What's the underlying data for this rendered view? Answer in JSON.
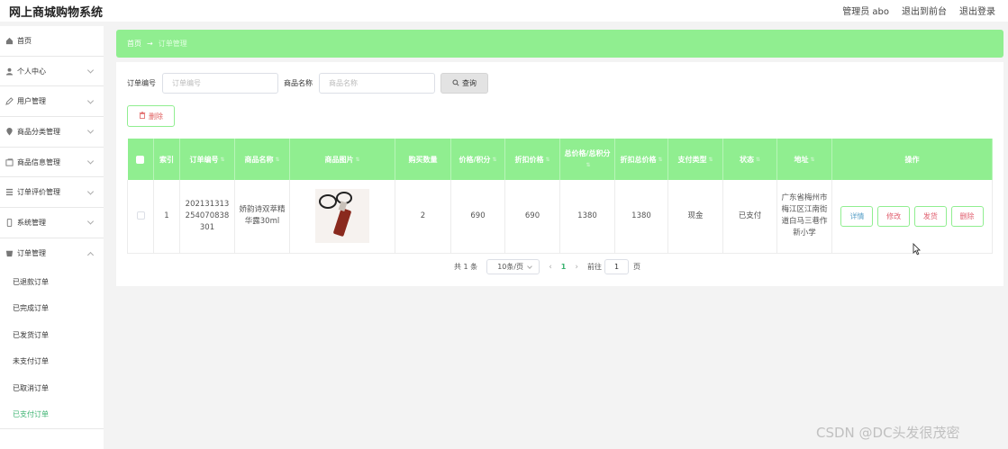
{
  "header": {
    "app_title": "网上商城购物系统",
    "admin": "管理员 abo",
    "to_front": "退出到前台",
    "logout": "退出登录"
  },
  "sidebar": {
    "items": [
      {
        "label": "首页",
        "icon": "home-icon"
      },
      {
        "label": "个人中心",
        "icon": "user-icon"
      },
      {
        "label": "用户管理",
        "icon": "edit-icon"
      },
      {
        "label": "商品分类管理",
        "icon": "location-icon"
      },
      {
        "label": "商品信息管理",
        "icon": "gallery-icon"
      },
      {
        "label": "订单评价管理",
        "icon": "list-icon"
      },
      {
        "label": "系统管理",
        "icon": "phone-icon"
      },
      {
        "label": "订单管理",
        "icon": "order-icon"
      }
    ],
    "order_sub": [
      "已退款订单",
      "已完成订单",
      "已发货订单",
      "未支付订单",
      "已取消订单",
      "已支付订单"
    ]
  },
  "breadcrumb": {
    "home": "首页",
    "arrow": "→",
    "current": "订单管理"
  },
  "search": {
    "order_no_label": "订单编号",
    "order_no_placeholder": "订单编号",
    "goods_label": "商品名称",
    "goods_placeholder": "商品名称",
    "query_button": "查询"
  },
  "actions": {
    "delete_button": "删除"
  },
  "table": {
    "headers": [
      "索引",
      "订单编号",
      "商品名称",
      "商品图片",
      "购买数量",
      "价格/积分",
      "折扣价格",
      "总价格/总积分",
      "折扣总价格",
      "支付类型",
      "状态",
      "地址",
      "操作"
    ],
    "rows": [
      {
        "index": "1",
        "order_no": "202131313254070838301",
        "goods_name": "娇韵诗双萃精华露30ml",
        "quantity": "2",
        "price": "690",
        "discount_price": "690",
        "total": "1380",
        "discount_total": "1380",
        "pay_type": "现金",
        "status": "已支付",
        "address": "广东省梅州市梅江区江南街道白马三巷作新小学",
        "ops": [
          "详情",
          "修改",
          "发货",
          "删除"
        ]
      }
    ]
  },
  "pager": {
    "total": "共 1 条",
    "page_size": "10条/页",
    "current": "1",
    "goto": "前往",
    "goto_value": "1",
    "page_unit": "页"
  },
  "watermark": "CSDN @DC头发很茂密"
}
